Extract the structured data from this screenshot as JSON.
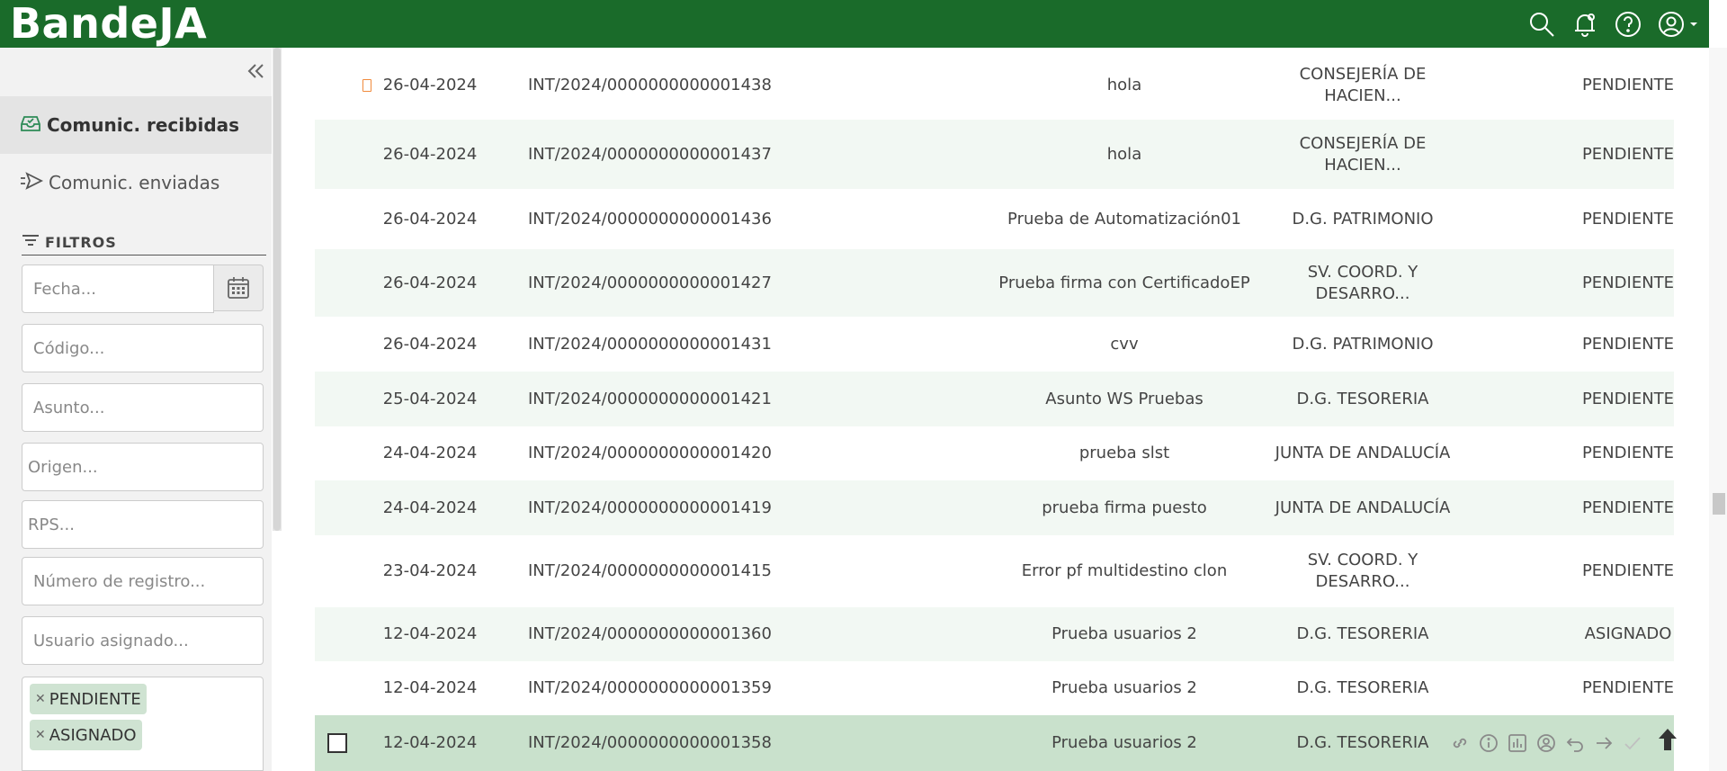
{
  "app": {
    "brand": "BandeJA"
  },
  "topbar": {
    "icons": [
      "search-icon",
      "notifications-icon",
      "help-icon",
      "user-account-icon"
    ]
  },
  "sidebar": {
    "items": [
      {
        "label": "Comunic. recibidas",
        "icon": "inbox-icon",
        "active": true
      },
      {
        "label": "Comunic. enviadas",
        "icon": "send-icon",
        "active": false
      }
    ],
    "filters": {
      "heading": "FILTROS",
      "fecha": "Fecha...",
      "codigo": "Código...",
      "asunto": "Asunto...",
      "origen": "Origen...",
      "rps": "RPS...",
      "numero_registro": "Número de registro...",
      "usuario_asignado": "Usuario asignado...",
      "estado_tags": [
        "PENDIENTE",
        "ASIGNADO"
      ]
    }
  },
  "table": {
    "rows": [
      {
        "date": "26-04-2024",
        "code": "INT/2024/0000000000001438",
        "subject": "hola",
        "origin": [
          "CONSEJERÍA DE",
          "HACIEN..."
        ],
        "status": "PENDIENTE",
        "flag": true
      },
      {
        "date": "26-04-2024",
        "code": "INT/2024/0000000000001437",
        "subject": "hola",
        "origin": [
          "CONSEJERÍA DE",
          "HACIEN..."
        ],
        "status": "PENDIENTE"
      },
      {
        "date": "26-04-2024",
        "code": "INT/2024/0000000000001436",
        "subject": "Prueba de Automatización01",
        "origin": [
          "D.G. PATRIMONIO"
        ],
        "status": "PENDIENTE"
      },
      {
        "date": "26-04-2024",
        "code": "INT/2024/0000000000001427",
        "subject": "Prueba firma con CertificadoEP",
        "origin": [
          "SV. COORD. Y",
          "DESARRO..."
        ],
        "status": "PENDIENTE"
      },
      {
        "date": "26-04-2024",
        "code": "INT/2024/0000000000001431",
        "subject": "cvv",
        "origin": [
          "D.G. PATRIMONIO"
        ],
        "status": "PENDIENTE"
      },
      {
        "date": "25-04-2024",
        "code": "INT/2024/0000000000001421",
        "subject": "Asunto WS Pruebas",
        "origin": [
          "D.G. TESORERIA"
        ],
        "status": "PENDIENTE"
      },
      {
        "date": "24-04-2024",
        "code": "INT/2024/0000000000001420",
        "subject": "prueba slst",
        "origin": [
          "JUNTA DE ANDALUCÍA"
        ],
        "status": "PENDIENTE"
      },
      {
        "date": "24-04-2024",
        "code": "INT/2024/0000000000001419",
        "subject": "prueba firma puesto",
        "origin": [
          "JUNTA DE ANDALUCÍA"
        ],
        "status": "PENDIENTE"
      },
      {
        "date": "23-04-2024",
        "code": "INT/2024/0000000000001415",
        "subject": "Error pf multidestino clon",
        "origin": [
          "SV. COORD. Y",
          "DESARRO..."
        ],
        "status": "PENDIENTE"
      },
      {
        "date": "12-04-2024",
        "code": "INT/2024/0000000000001360",
        "subject": "Prueba usuarios 2",
        "origin": [
          "D.G. TESORERIA"
        ],
        "status": "ASIGNADO"
      },
      {
        "date": "12-04-2024",
        "code": "INT/2024/0000000000001359",
        "subject": "Prueba usuarios 2",
        "origin": [
          "D.G. TESORERIA"
        ],
        "status": "PENDIENTE"
      },
      {
        "date": "12-04-2024",
        "code": "INT/2024/0000000000001358",
        "subject": "Prueba usuarios 2",
        "origin": [
          "D.G. TESORERIA"
        ],
        "status": "",
        "selected": true
      }
    ],
    "row_actions": [
      "link-icon",
      "info-icon",
      "chart-icon",
      "user-assign-icon",
      "undo-icon",
      "forward-arrow-icon",
      "check-icon"
    ]
  },
  "scroll_to_top_icon": "arrow-up-icon"
}
